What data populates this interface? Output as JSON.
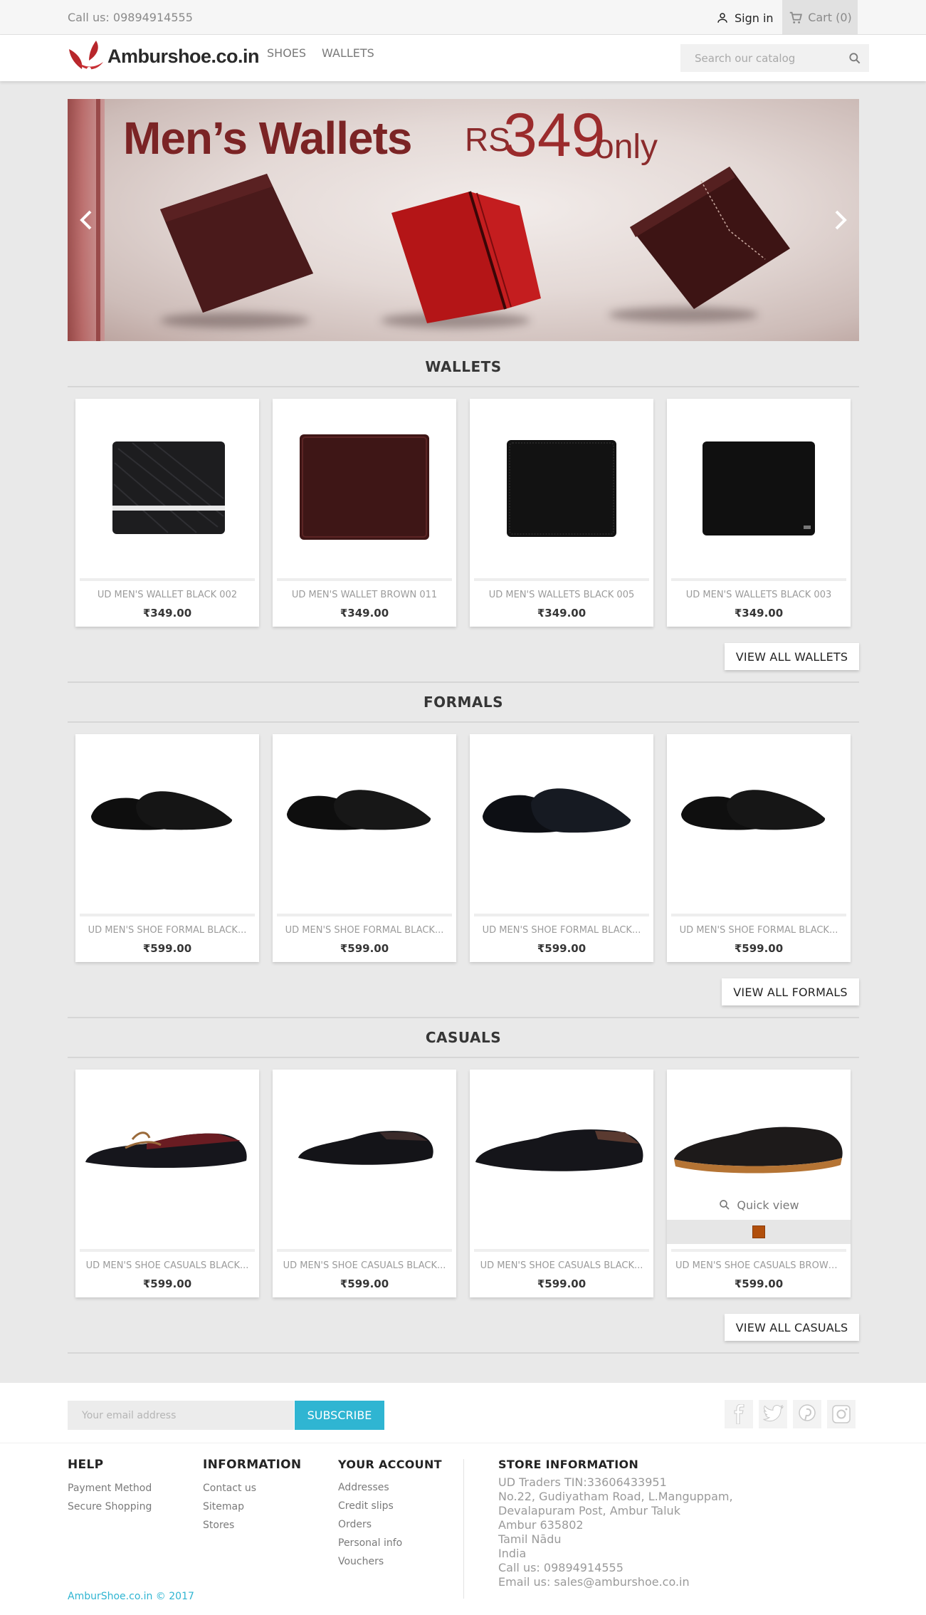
{
  "topbar": {
    "call": "Call us: 09894914555",
    "signin": "Sign in",
    "cart": "Cart (0)"
  },
  "header": {
    "logo_text": "Amburshoe.co.in",
    "menu": [
      "SHOES",
      "WALLETS"
    ],
    "search_placeholder": "Search our catalog"
  },
  "banner": {
    "title": "Men’s Wallets",
    "currency": "RS",
    "price": "349",
    "suffix": "only"
  },
  "sections": [
    {
      "title": "WALLETS",
      "view_all": "VIEW ALL WALLETS",
      "products": [
        {
          "name": "UD MEN'S WALLET BLACK 002",
          "price": "₹349.00"
        },
        {
          "name": "UD MEN'S WALLET BROWN 011",
          "price": "₹349.00"
        },
        {
          "name": "UD MEN'S WALLETS BLACK 005",
          "price": "₹349.00"
        },
        {
          "name": "UD MEN'S WALLETS BLACK 003",
          "price": "₹349.00"
        }
      ]
    },
    {
      "title": "FORMALS",
      "view_all": "VIEW ALL FORMALS",
      "products": [
        {
          "name": "UD MEN'S SHOE FORMAL BLACK...",
          "price": "₹599.00"
        },
        {
          "name": "UD MEN'S SHOE FORMAL BLACK...",
          "price": "₹599.00"
        },
        {
          "name": "UD MEN'S SHOE FORMAL BLACK...",
          "price": "₹599.00"
        },
        {
          "name": "UD MEN'S SHOE FORMAL BLACK...",
          "price": "₹599.00"
        }
      ]
    },
    {
      "title": "CASUALS",
      "view_all": "VIEW ALL CASUALS",
      "products": [
        {
          "name": "UD MEN'S SHOE CASUALS BLACK...",
          "price": "₹599.00"
        },
        {
          "name": "UD MEN'S SHOE CASUALS BLACK...",
          "price": "₹599.00"
        },
        {
          "name": "UD MEN'S SHOE CASUALS BLACK...",
          "price": "₹599.00"
        },
        {
          "name": "UD MEN'S SHOE CASUALS BROWN...",
          "price": "₹599.00"
        }
      ],
      "quick_view": "Quick view",
      "swatch_color": "#b14f0c"
    }
  ],
  "newsletter": {
    "placeholder": "Your email address",
    "button": "SUBSCRIBE",
    "social": [
      "facebook-icon",
      "twitter-icon",
      "pinterest-icon",
      "instagram-icon"
    ]
  },
  "footer": {
    "help": {
      "title": "HELP",
      "links": [
        "Payment Method",
        "Secure Shopping"
      ]
    },
    "information": {
      "title": "INFORMATION",
      "links": [
        "Contact us",
        "Sitemap",
        "Stores"
      ]
    },
    "account": {
      "title": "YOUR ACCOUNT",
      "links": [
        "Addresses",
        "Credit slips",
        "Orders",
        "Personal info",
        "Vouchers"
      ]
    },
    "store": {
      "title": "STORE INFORMATION",
      "lines": [
        "UD Traders TIN:33606433951",
        "No.22, Gudiyatham Road, L.Manguppam,",
        "Devalapuram Post, Ambur Taluk",
        "Ambur 635802",
        "Tamil Nādu",
        "India",
        "Call us: 09894914555",
        "Email us: sales@amburshoe.co.in"
      ]
    },
    "copyright": "AmburShoe.co.in © 2017"
  },
  "colors": {
    "accent": "#2fb5d2",
    "banner_text": "#7b2425"
  }
}
